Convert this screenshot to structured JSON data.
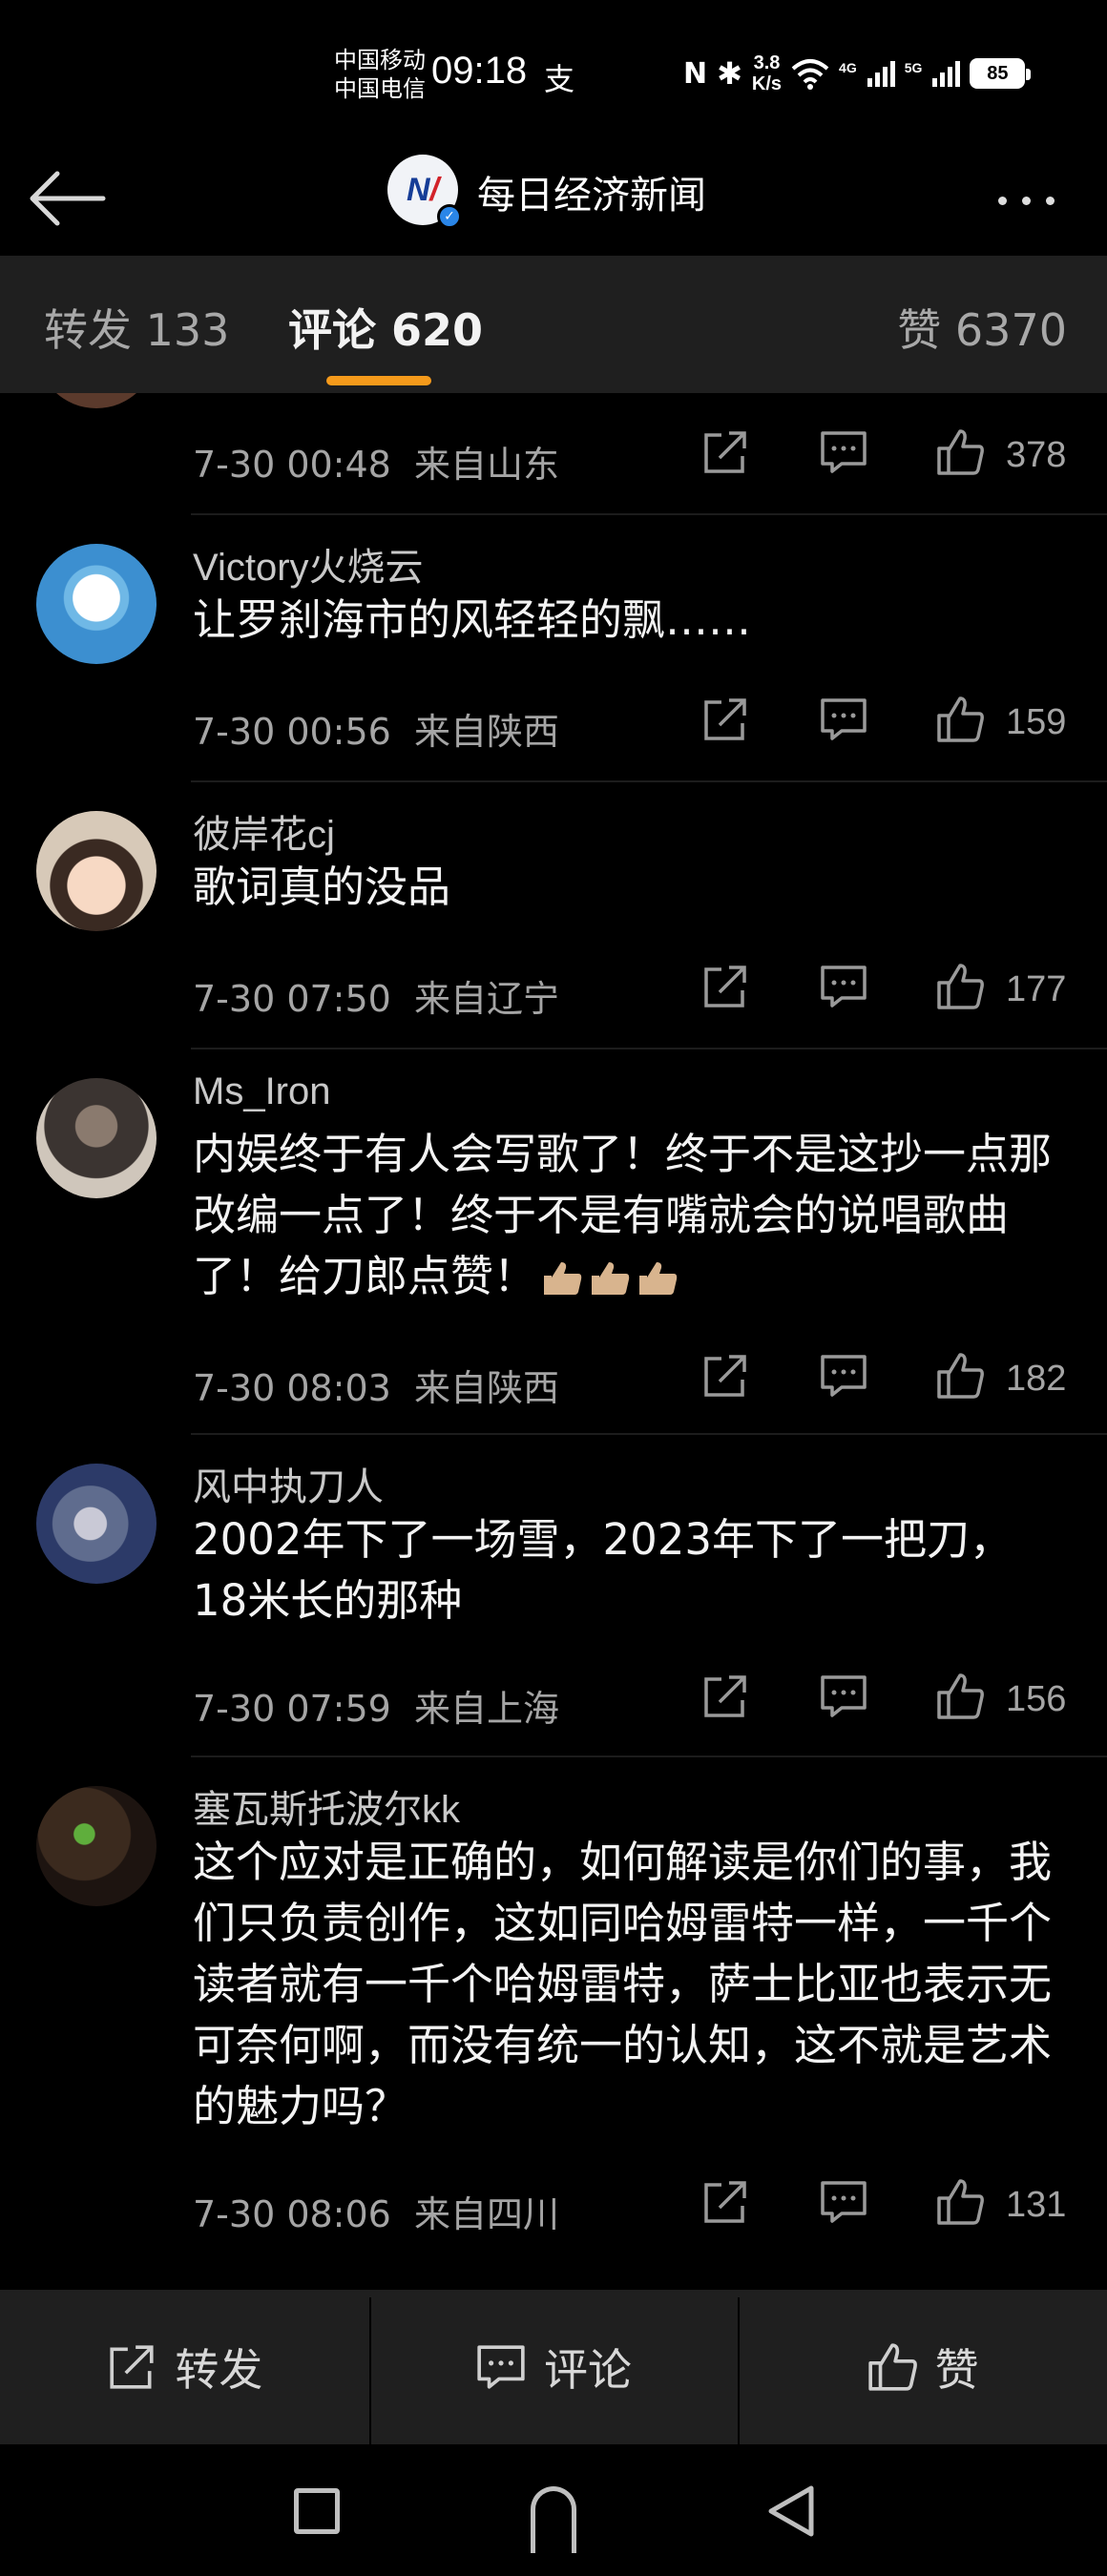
{
  "status_bar": {
    "carrier1": "中国移动",
    "carrier2": "中国电信",
    "time": "09:18",
    "alipay_glyph": "支",
    "nfc": "N",
    "bluetooth_glyph": "✱",
    "speed_value": "3.8",
    "speed_unit": "K/s",
    "wifi_icon": "wifi-icon",
    "sig1_label": "4G",
    "sig2_label": "5G",
    "battery": "85"
  },
  "header": {
    "title": "每日经济新闻",
    "back_icon": "back-arrow-icon",
    "more_icon": "more-dots-icon"
  },
  "tabs": {
    "repost_label": "转发 133",
    "comment_label": "评论 620",
    "like_label": "赞 6370",
    "accent": "#f59a1b"
  },
  "comments": [
    {
      "user": "",
      "text": "",
      "time": "7-30 00:48",
      "location": "来自山东",
      "likes": "378"
    },
    {
      "user": "Victory火烧云",
      "text": "让罗刹海市的风轻轻的飘……",
      "time": "7-30 00:56",
      "location": "来自陕西",
      "likes": "159"
    },
    {
      "user": "彼岸花cj",
      "text": "歌词真的没品",
      "time": "7-30 07:50",
      "location": "来自辽宁",
      "likes": "177"
    },
    {
      "user": "Ms_Iron",
      "text": "内娱终于有人会写歌了！终于不是这抄一点那改编一点了！终于不是有嘴就会的说唱歌曲了！给刀郎点赞！",
      "emoji": "👍👍👍",
      "time": "7-30 08:03",
      "location": "来自陕西",
      "likes": "182"
    },
    {
      "user": "风中执刀人",
      "text": "2002年下了一场雪，2023年下了一把刀，18米长的那种",
      "time": "7-30 07:59",
      "location": "来自上海",
      "likes": "156"
    },
    {
      "user": "塞瓦斯托波尔kk",
      "text": "这个应对是正确的，如何解读是你们的事，我们只负责创作，这如同哈姆雷特一样，一千个读者就有一千个哈姆雷特，萨士比亚也表示无可奈何啊，而没有统一的认知，这不就是艺术的魅力吗？",
      "time": "7-30 08:06",
      "location": "来自四川",
      "likes": "131"
    }
  ],
  "bottom_bar": {
    "repost": "转发",
    "comment": "评论",
    "like": "赞"
  },
  "system_nav": {
    "recent_icon": "square-icon",
    "home_icon": "home-pill-icon",
    "back_icon": "triangle-back-icon"
  }
}
